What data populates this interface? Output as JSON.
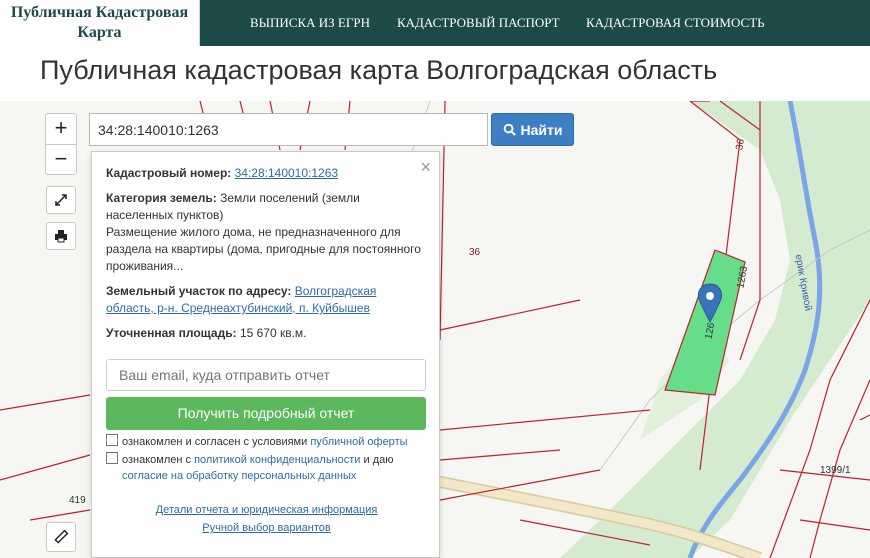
{
  "header": {
    "logo_line1": "Публичная Кадастровая",
    "logo_line2": "Карта",
    "nav": [
      "ВЫПИСКА ИЗ ЕГРН",
      "КАДАСТРОВЫЙ ПАСПОРТ",
      "КАДАСТРОВАЯ СТОИМОСТЬ"
    ]
  },
  "page_title": "Публичная кадастровая карта Волгоградская область",
  "search": {
    "value": "34:28:140010:1263",
    "button_label": "Найти"
  },
  "map": {
    "zoom_in": "+",
    "zoom_out": "−",
    "labels": {
      "parcel_36_top": "36",
      "parcel_36_mid": "36",
      "parcel_1263": "1263",
      "parcel_1263_partial": "126",
      "river": "ерик Кривой",
      "parcel_1399": "1399/1",
      "parcel_419": "419"
    },
    "colors": {
      "parcel_fill": "#66dd88",
      "boundary": "#c0202e",
      "river": "#7aa6e8"
    }
  },
  "popup": {
    "close": "×",
    "cadastral_label": "Кадастровый номер:",
    "cadastral_value": "34:28:140010:1263",
    "category_label": "Категория земель:",
    "category_value": "Земли поселений (земли",
    "category_value_2": "населенных пунктов)",
    "usage_1": "Размещение жилого дома, не предназначенного для",
    "usage_2": "раздела на квартиры (дома, пригодные для постоянного",
    "usage_3": "проживания...",
    "address_label": "Земельный участок по адресу:",
    "address_value_1": "Волгоградская",
    "address_value_2": "область, р-н. Среднеахтубинский, п. Куйбышев",
    "area_label": "Уточненная площадь:",
    "area_value": "15 670 кв.м.",
    "email_placeholder": "Ваш email, куда отправить отчет",
    "report_button": "Получить подробный отчет",
    "consent1_text": "ознакомлен и согласен с условиями",
    "consent1_link": "публичной оферты",
    "consent2_text1": "ознакомлен с",
    "consent2_link1": "политикой конфиденциальности",
    "consent2_text2": "и даю",
    "consent2_link2": "согласие на обработку персональных данных",
    "details_link": "Детали отчета и юридическая информация",
    "manual_link": "Ручной выбор вариантов"
  }
}
